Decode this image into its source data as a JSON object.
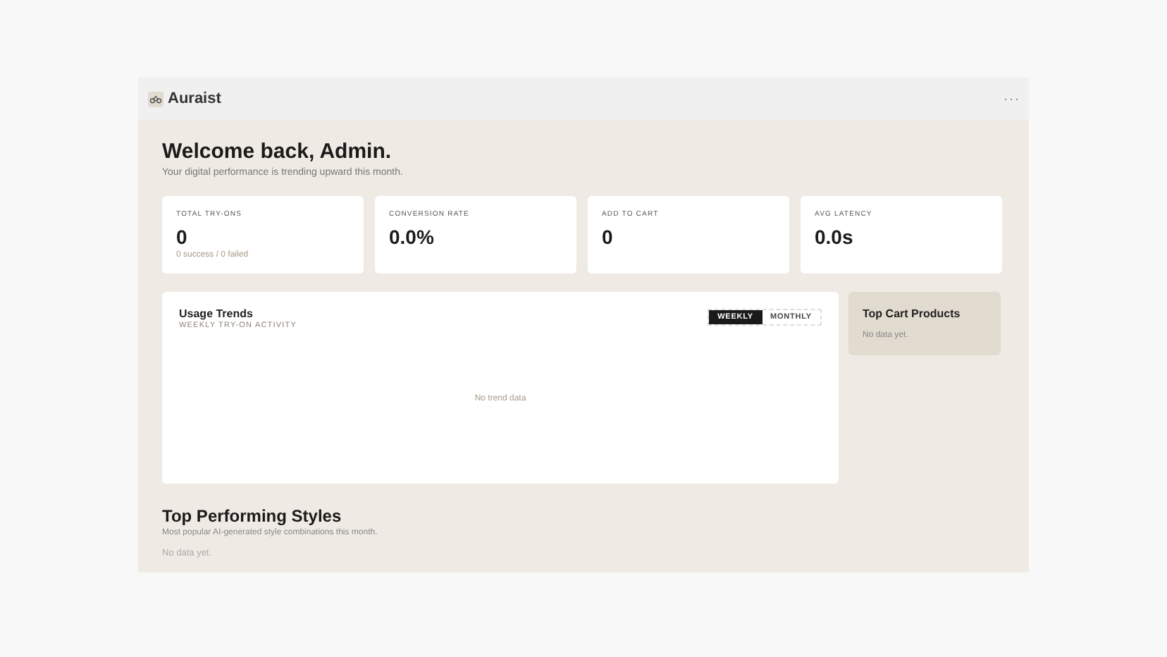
{
  "app": {
    "name": "Auraist",
    "menu": "···"
  },
  "welcome": {
    "title": "Welcome back, Admin.",
    "subtitle": "Your digital performance is trending upward this month."
  },
  "stats": [
    {
      "label": "TOTAL TRY-ONS",
      "value": "0",
      "detail": "0 success / 0 failed"
    },
    {
      "label": "CONVERSION RATE",
      "value": "0.0%"
    },
    {
      "label": "ADD TO CART",
      "value": "0"
    },
    {
      "label": "AVG LATENCY",
      "value": "0.0s"
    }
  ],
  "usage_trends": {
    "title": "Usage Trends",
    "subtitle": "WEEKLY TRY-ON ACTIVITY",
    "tabs": [
      {
        "label": "WEEKLY",
        "selected": true
      },
      {
        "label": "MONTHLY",
        "selected": false
      }
    ],
    "empty": "No trend data"
  },
  "top_cart_products": {
    "title": "Top Cart Products",
    "empty": "No data yet."
  },
  "top_performing_styles": {
    "title": "Top Performing Styles",
    "subtitle": "Most popular AI-generated style combinations this month.",
    "empty": "No data yet."
  }
}
